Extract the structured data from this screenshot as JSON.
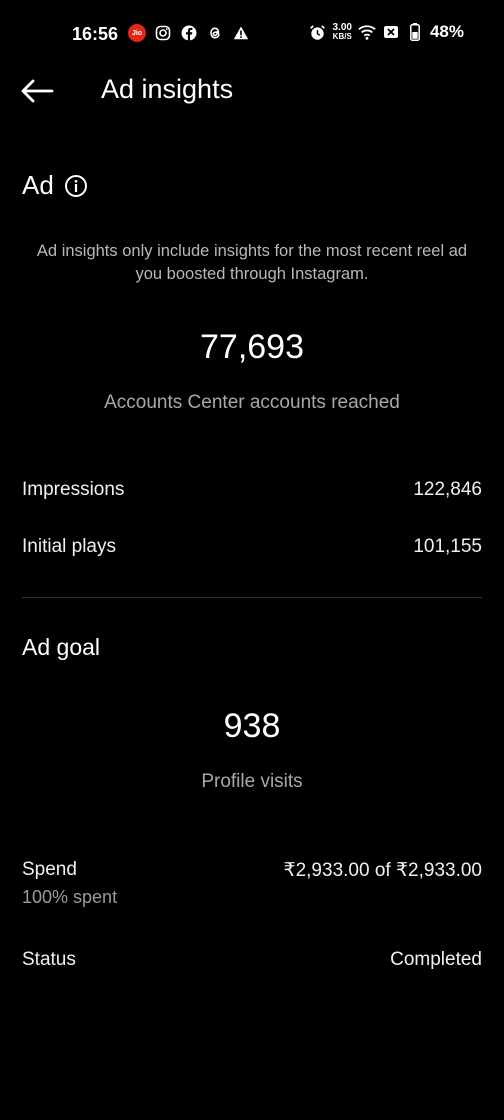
{
  "status_bar": {
    "time": "16:56",
    "left_icons": [
      "jio-icon",
      "instagram-icon",
      "facebook-icon",
      "threads-icon",
      "warning-icon"
    ],
    "jio_text": "Jio",
    "speed_value": "3.00",
    "speed_unit": "KB/S",
    "battery_percent": "48%"
  },
  "app_bar": {
    "title": "Ad insights"
  },
  "ad_section": {
    "heading": "Ad",
    "notice": "Ad insights only include insights for the most recent reel ad you boosted through Instagram.",
    "reach_value": "77,693",
    "reach_label": "Accounts Center accounts reached",
    "metrics": [
      {
        "label": "Impressions",
        "value": "122,846"
      },
      {
        "label": "Initial plays",
        "value": "101,155"
      }
    ]
  },
  "ad_goal": {
    "heading": "Ad goal",
    "value": "938",
    "label": "Profile visits",
    "spend_label": "Spend",
    "spend_value": "₹2,933.00 of ₹2,933.00",
    "spend_sub": "100% spent",
    "status_label": "Status",
    "status_value": "Completed"
  }
}
